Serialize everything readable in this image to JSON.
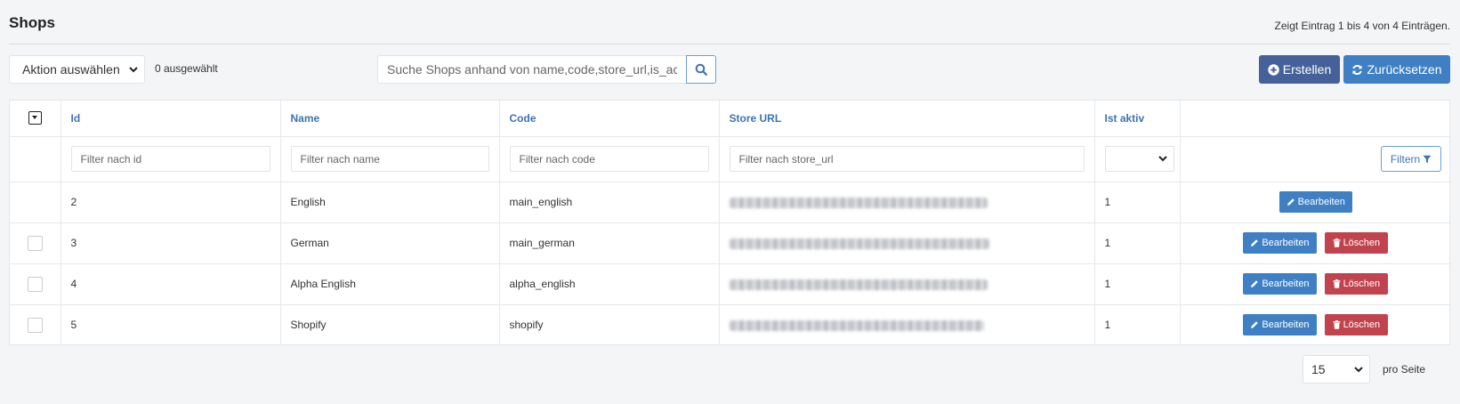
{
  "header": {
    "title": "Shops",
    "entries_info": "Zeigt Eintrag 1 bis 4 von 4 Einträgen."
  },
  "toolbar": {
    "action_select": "Aktion auswählen",
    "selected_count": "0 ausgewählt",
    "search_placeholder": "Suche Shops anhand von name,code,store_url,is_active",
    "create_label": "Erstellen",
    "reset_label": "Zurücksetzen"
  },
  "table": {
    "columns": [
      "Id",
      "Name",
      "Code",
      "Store URL",
      "Ist aktiv"
    ],
    "filters": {
      "id": "Filter nach id",
      "name": "Filter nach name",
      "code": "Filter nach code",
      "store_url": "Filter nach store_url",
      "filter_button": "Filtern"
    },
    "rows": [
      {
        "id": "2",
        "name": "English",
        "code": "main_english",
        "store_url_redacted": true,
        "is_active": "1",
        "edit_label": "Bearbeiten",
        "has_checkbox": false,
        "has_delete": false
      },
      {
        "id": "3",
        "name": "German",
        "code": "main_german",
        "store_url_redacted": true,
        "is_active": "1",
        "edit_label": "Bearbeiten",
        "delete_label": "Löschen",
        "has_checkbox": true,
        "has_delete": true
      },
      {
        "id": "4",
        "name": "Alpha English",
        "code": "alpha_english",
        "store_url_redacted": true,
        "is_active": "1",
        "edit_label": "Bearbeiten",
        "delete_label": "Löschen",
        "has_checkbox": true,
        "has_delete": true
      },
      {
        "id": "5",
        "name": "Shopify",
        "code": "shopify",
        "store_url_redacted": true,
        "is_active": "1",
        "edit_label": "Bearbeiten",
        "delete_label": "Löschen",
        "has_checkbox": true,
        "has_delete": true
      }
    ]
  },
  "pagination": {
    "per_page": "15",
    "per_page_label": "pro Seite"
  },
  "colors": {
    "accent_blue": "#3f7fc3",
    "create_blue": "#46619a",
    "header_text_blue": "#3d73b3",
    "delete_red": "#c0434d"
  },
  "icons": {
    "search": "search-icon",
    "create": "plus-circle-icon",
    "reset": "refresh-icon",
    "filter": "filter-icon",
    "edit": "pencil-icon",
    "delete": "trash-icon",
    "dropdown": "chevron-down-icon"
  }
}
